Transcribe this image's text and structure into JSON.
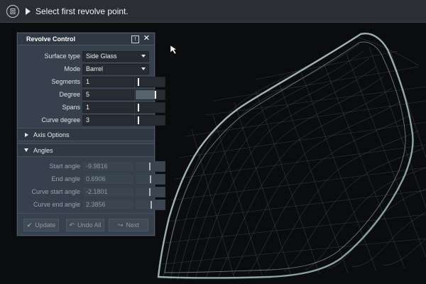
{
  "topbar": {
    "prompt": "Select first revolve point."
  },
  "panel": {
    "title": "Revolve Control",
    "pin_label": "!",
    "close_label": "✕",
    "surface_type": {
      "label": "Surface type",
      "value": "Side Glass"
    },
    "mode": {
      "label": "Mode",
      "value": "Barrel"
    },
    "segments": {
      "label": "Segments",
      "value": "1"
    },
    "degree": {
      "label": "Degree",
      "value": "5"
    },
    "spans": {
      "label": "Spans",
      "value": "1"
    },
    "curve_degree": {
      "label": "Curve degree",
      "value": "3"
    },
    "axis_options": "Axis Options",
    "angles": "Angles",
    "start_angle": {
      "label": "Start angle",
      "value": "-9.9816"
    },
    "end_angle": {
      "label": "End angle",
      "value": "0.6906"
    },
    "curve_start_angle": {
      "label": "Curve start angle",
      "value": "-2.1801"
    },
    "curve_end_angle": {
      "label": "Curve end angle",
      "value": "2.3856"
    },
    "buttons": {
      "update": "Update",
      "undo_all": "Undo All",
      "next": "Next"
    }
  },
  "icons": {
    "prompt_icon": "document-icon",
    "cursor": "pick-cursor-icon"
  }
}
